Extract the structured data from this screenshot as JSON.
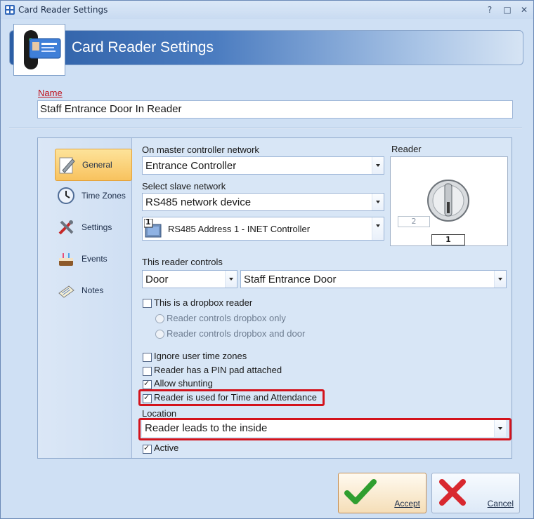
{
  "window": {
    "title": "Card Reader Settings",
    "controls": [
      "?",
      "□",
      "✕"
    ]
  },
  "header": {
    "title": "Card Reader Settings"
  },
  "name": {
    "label": "Name",
    "value": "Staff Entrance Door In Reader"
  },
  "nav": [
    {
      "label": "General",
      "icon": "pencil-paper-icon",
      "active": true
    },
    {
      "label": "Time Zones",
      "icon": "clock-icon",
      "active": false
    },
    {
      "label": "Settings",
      "icon": "tools-icon",
      "active": false
    },
    {
      "label": "Events",
      "icon": "cake-icon",
      "active": false
    },
    {
      "label": "Notes",
      "icon": "notes-icon",
      "active": false
    }
  ],
  "general": {
    "master_label": "On master controller network",
    "master_value": "Entrance Controller",
    "slave_label": "Select slave network",
    "slave_value": "RS485 network device",
    "address_badge": "1",
    "address_value": "RS485 Address 1 - INET Controller",
    "reader_label": "Reader",
    "reader_option_a": "2",
    "reader_option_b": "1",
    "controls_label": "This reader controls",
    "controls_type": "Door",
    "controls_target": "Staff Entrance Door",
    "dropbox_label": "This is a dropbox reader",
    "dropbox_only": "Reader controls dropbox only",
    "dropbox_door": "Reader controls dropbox and door",
    "ignore_tz": "Ignore user time zones",
    "pin_pad": "Reader has a PIN pad attached",
    "shunting": "Allow shunting",
    "time_attendance": "Reader is used for Time and Attendance",
    "location_label": "Location",
    "location_value": "Reader leads to the inside",
    "active": "Active"
  },
  "buttons": {
    "accept": "Accept",
    "cancel": "Cancel"
  },
  "colors": {
    "highlight": "#d3131c",
    "header_blue": "#2c5ea5",
    "label_red": "#c0101a"
  }
}
